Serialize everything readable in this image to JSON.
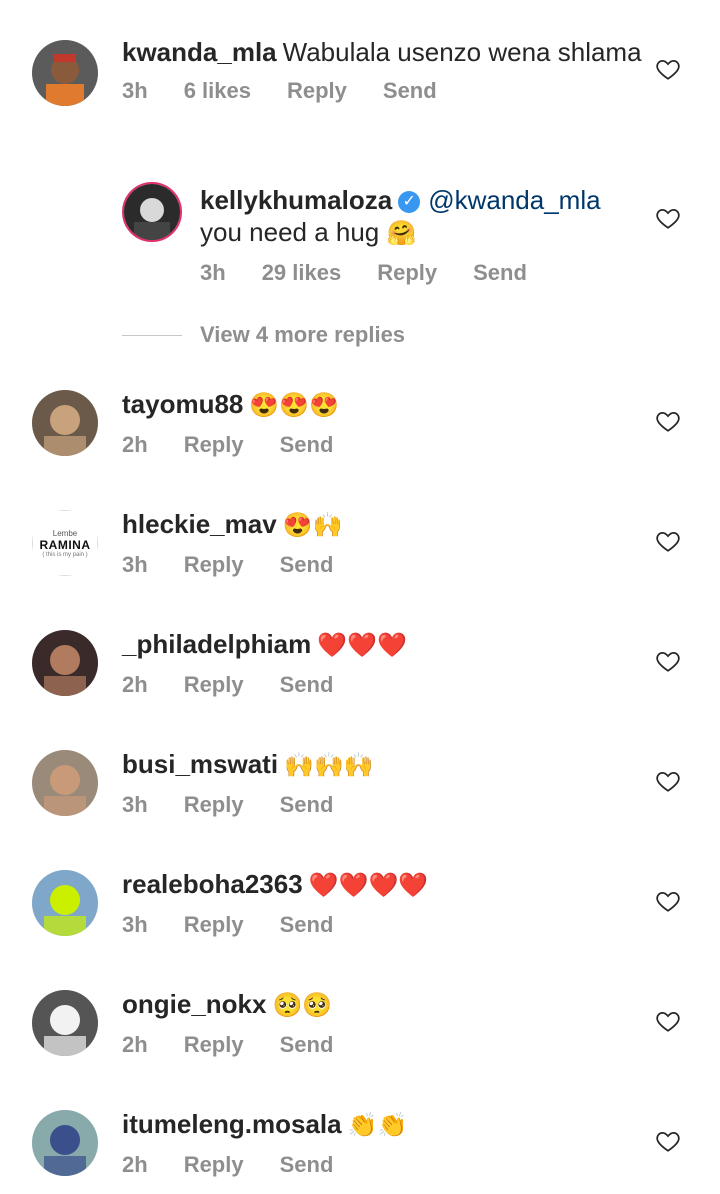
{
  "comments": [
    {
      "username": "kwanda_mla",
      "text": "Wabulala usenzo wena shlama",
      "time": "3h",
      "likes": "6 likes",
      "reply": "Reply",
      "send": "Send"
    },
    {
      "username": "kellykhumaloza",
      "mention": "@kwanda_mla",
      "text": "you need a hug",
      "emoji": "🤗",
      "time": "3h",
      "likes": "29 likes",
      "reply": "Reply",
      "send": "Send"
    },
    {
      "username": "tayomu88",
      "emoji": "😍😍😍",
      "time": "2h",
      "reply": "Reply",
      "send": "Send"
    },
    {
      "username": "hleckie_mav",
      "emoji": "😍🙌",
      "time": "3h",
      "reply": "Reply",
      "send": "Send",
      "avatar_text": [
        "Lembe",
        "RAMINA",
        "( this is my pain )"
      ]
    },
    {
      "username": "_philadelphiam",
      "emoji": "❤️❤️❤️",
      "time": "2h",
      "reply": "Reply",
      "send": "Send"
    },
    {
      "username": "busi_mswati",
      "emoji": "🙌🙌🙌",
      "time": "3h",
      "reply": "Reply",
      "send": "Send"
    },
    {
      "username": "realeboha2363",
      "emoji": "❤️❤️❤️❤️",
      "time": "3h",
      "reply": "Reply",
      "send": "Send"
    },
    {
      "username": "ongie_nokx",
      "emoji": "🥺🥺",
      "time": "2h",
      "reply": "Reply",
      "send": "Send"
    },
    {
      "username": "itumeleng.mosala",
      "emoji": "👏👏",
      "time": "2h",
      "reply": "Reply",
      "send": "Send"
    }
  ],
  "view_more_replies": "View 4 more replies",
  "colors": {
    "text": "#262626",
    "meta": "#8e8e8e",
    "mention": "#00376b",
    "verified": "#3897f0"
  }
}
